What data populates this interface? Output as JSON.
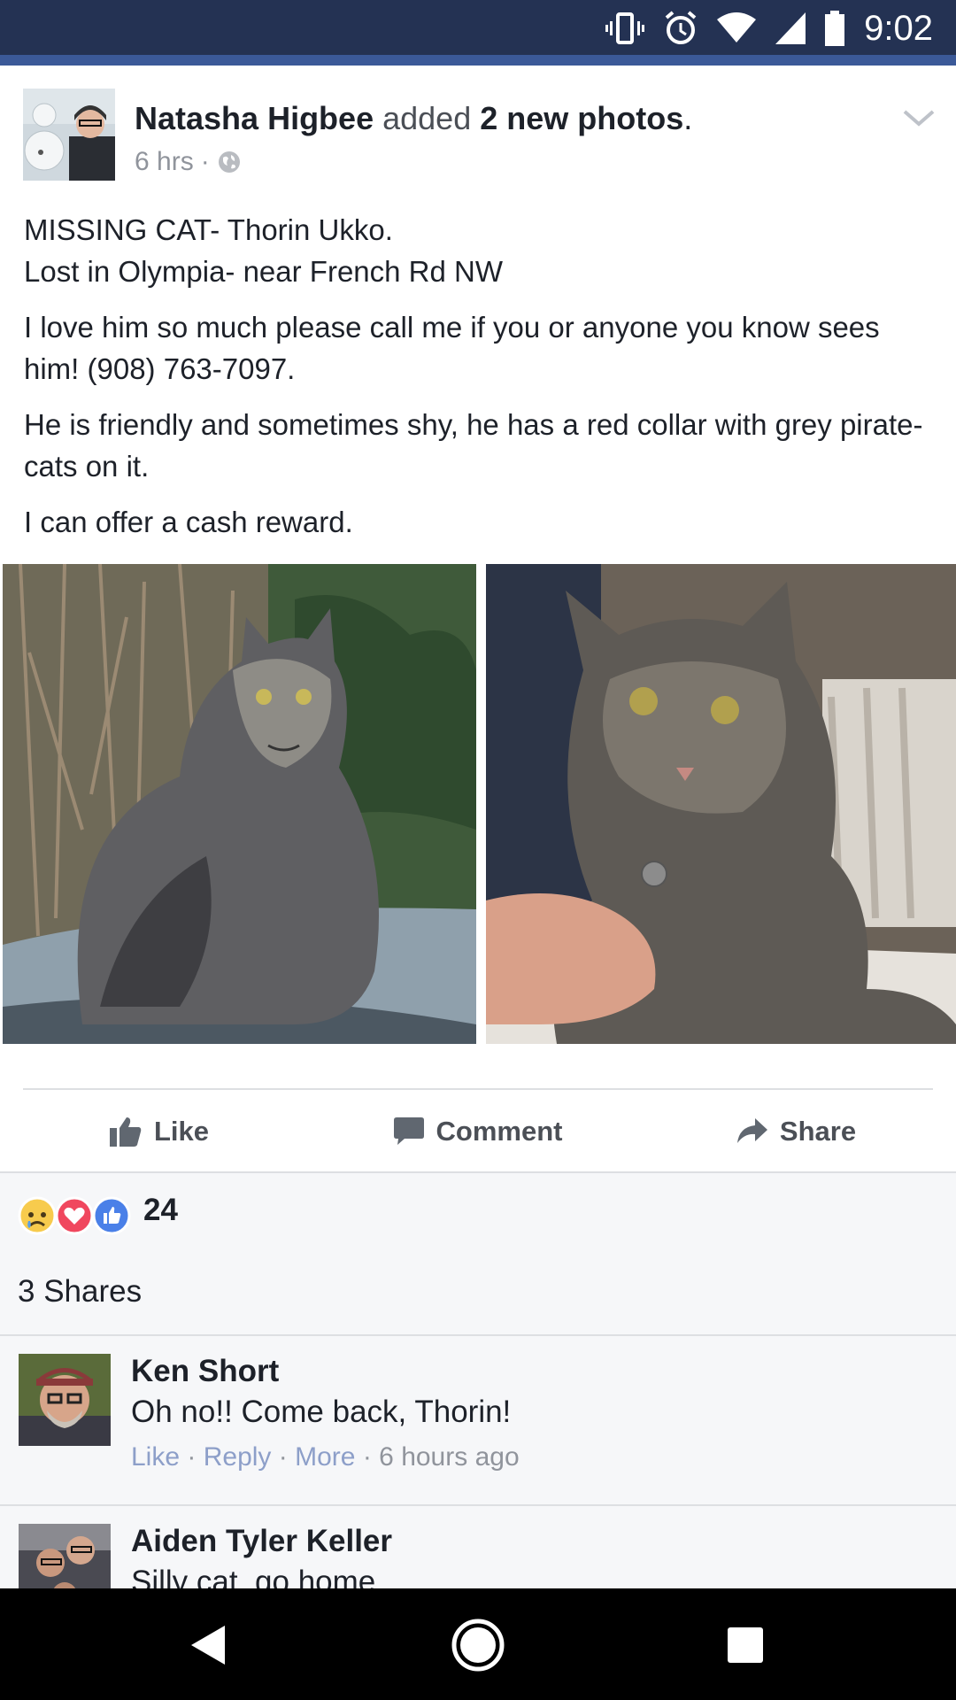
{
  "status_bar": {
    "time": "9:02",
    "icons": [
      "vibrate-icon",
      "alarm-icon",
      "wifi-icon",
      "signal-icon",
      "battery-icon"
    ]
  },
  "post": {
    "author": "Natasha Higbee",
    "action_text": "added",
    "object_text": "2 new photos",
    "period": ".",
    "time": "6 hrs",
    "separator": "·",
    "privacy_icon": "globe-icon",
    "menu_icon": "chevron-down-icon",
    "paragraphs": [
      "MISSING CAT- Thorin Ukko.\nLost in Olympia- near French Rd NW",
      "I love him so much please call me if you or anyone you know sees him! (908) 763-7097.",
      "He is friendly and sometimes shy, he has a red collar with grey pirate-cats on it.",
      "I can offer a cash reward."
    ],
    "photos": [
      "cat-photo-outdoor",
      "cat-photo-indoor"
    ]
  },
  "actions": {
    "like": "Like",
    "comment": "Comment",
    "share": "Share"
  },
  "reactions": {
    "types": [
      "sad",
      "love",
      "like"
    ],
    "count": "24"
  },
  "shares_text": "3 Shares",
  "comments": [
    {
      "name": "Ken Short",
      "text": "Oh no!! Come back, Thorin!",
      "like": "Like",
      "reply": "Reply",
      "more": "More",
      "sep": "·",
      "time": "6 hours ago"
    },
    {
      "name": "Aiden Tyler Keller",
      "text": "Silly cat, go home"
    }
  ],
  "colors": {
    "status_bar": "#243253",
    "fb_blue": "#3b5998",
    "link_grey": "#8d9fc9",
    "meta_grey": "#90949c",
    "feed_grey": "#f6f7f9"
  }
}
